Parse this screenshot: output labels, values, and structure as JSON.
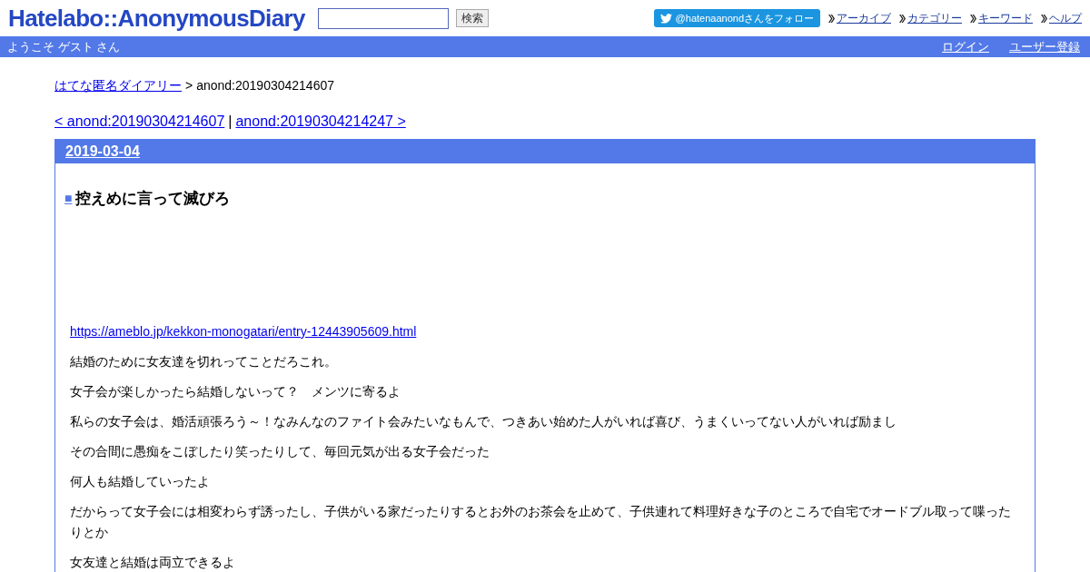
{
  "header": {
    "logo": "Hatelabo::AnonymousDiary",
    "search": {
      "button": "検索"
    },
    "twitter_follow": "@hatenaanondさんをフォロー",
    "nav": [
      "アーカイブ",
      "カテゴリー",
      "キーワード",
      "ヘルプ"
    ]
  },
  "user_bar": {
    "welcome": "ようこそ ゲスト さん",
    "links": [
      "ログイン",
      "ユーザー登録"
    ]
  },
  "breadcrumb": {
    "home": "はてな匿名ダイアリー",
    "separator": ">",
    "current": "anond:20190304214607"
  },
  "pager": {
    "prev": "< anond:20190304214607",
    "separator": "|",
    "next": "anond:20190304214247 >"
  },
  "day": {
    "date": "2019-03-04",
    "entry": {
      "mark": "■",
      "title": "控えめに言って滅びろ",
      "link": "https://ameblo.jp/kekkon-monogatari/entry-12443905609.html",
      "paragraphs": [
        "結婚のために女友達を切れってことだろこれ。",
        "女子会が楽しかったら結婚しないって？　メンツに寄るよ",
        "私らの女子会は、婚活頑張ろう～！なみんなのファイト会みたいなもんで、つきあい始めた人がいれば喜び、うまくいってない人がいれば励まし",
        "その合間に愚痴をこぼしたり笑ったりして、毎回元気が出る女子会だった",
        "何人も結婚していったよ",
        "だからって女子会には相変わらず誘ったし、子供がいる家だったりするとお外のお茶会を止めて、子供連れて料理好きな子のところで自宅でオードブル取って喋ったりとか",
        "女友達と結婚は両立できるよ"
      ]
    }
  }
}
